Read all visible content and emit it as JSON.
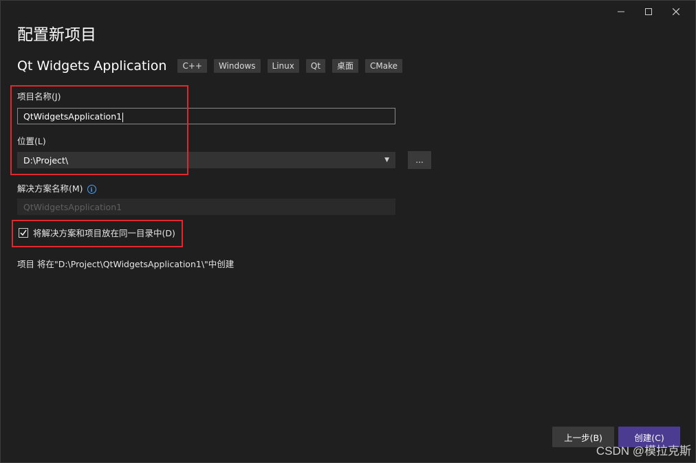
{
  "header": {
    "title": "配置新项目",
    "template_name": "Qt Widgets Application",
    "tags": [
      "C++",
      "Windows",
      "Linux",
      "Qt",
      "桌面",
      "CMake"
    ]
  },
  "form": {
    "project_name_label": "项目名称(J)",
    "project_name_value": "QtWidgetsApplication1",
    "location_label": "位置(L)",
    "location_value": "D:\\Project\\",
    "browse_label": "...",
    "solution_name_label": "解决方案名称(M)",
    "solution_name_value": "QtWidgetsApplication1",
    "same_dir_label": "将解决方案和项目放在同一目录中(D)",
    "same_dir_checked": true,
    "path_info": "项目 将在\"D:\\Project\\QtWidgetsApplication1\\\"中创建"
  },
  "footer": {
    "back_label": "上一步(B)",
    "create_label": "创建(C)"
  },
  "watermark": "CSDN @模拉克斯",
  "colors": {
    "background": "#1f1f1f",
    "accent": "#4b3c91",
    "highlight_box": "#e0282e",
    "info": "#4aa3ff"
  }
}
